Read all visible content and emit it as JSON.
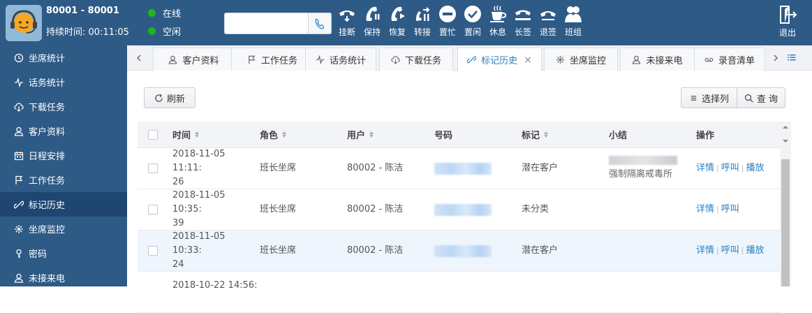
{
  "agent": {
    "id_label": "80001 - 80001",
    "duration_label": "持续时间:",
    "duration_value": "00:11:05"
  },
  "status": {
    "online": "在线",
    "idle": "空闲",
    "dot_color": "#1fb51f"
  },
  "dial": {
    "value": "",
    "placeholder": ""
  },
  "toolbar": [
    {
      "label": "挂断",
      "icon": "hangup-icon"
    },
    {
      "label": "保持",
      "icon": "hold-icon"
    },
    {
      "label": "恢复",
      "icon": "resume-icon"
    },
    {
      "label": "转接",
      "icon": "transfer-icon"
    },
    {
      "label": "置忙",
      "icon": "busy-icon"
    },
    {
      "label": "置闲",
      "icon": "idle-icon"
    },
    {
      "label": "休息",
      "icon": "rest-icon"
    },
    {
      "label": "长签",
      "icon": "long-sign-icon"
    },
    {
      "label": "退签",
      "icon": "sign-out-icon"
    },
    {
      "label": "班组",
      "icon": "team-icon"
    }
  ],
  "logout": {
    "label": "退出"
  },
  "sidebar": {
    "items": [
      {
        "label": "坐席统计",
        "icon": "agent-stats-icon"
      },
      {
        "label": "话务统计",
        "icon": "call-stats-icon"
      },
      {
        "label": "下载任务",
        "icon": "download-icon"
      },
      {
        "label": "客户资料",
        "icon": "customer-icon"
      },
      {
        "label": "日程安排",
        "icon": "calendar-icon"
      },
      {
        "label": "工作任务",
        "icon": "flag-icon"
      },
      {
        "label": "标记历史",
        "icon": "link-icon",
        "active": true
      },
      {
        "label": "坐席监控",
        "icon": "monitor-icon"
      },
      {
        "label": "密码",
        "icon": "key-icon"
      },
      {
        "label": "未接来电",
        "icon": "missed-call-icon"
      }
    ]
  },
  "tabs": [
    {
      "label": "客户资料",
      "icon": "customer-icon"
    },
    {
      "label": "工作任务",
      "icon": "flag-icon"
    },
    {
      "label": "话务统计",
      "icon": "call-stats-icon"
    },
    {
      "label": "下载任务",
      "icon": "download-icon"
    },
    {
      "label": "标记历史",
      "icon": "link-icon",
      "active": true,
      "closable": true
    },
    {
      "label": "坐席监控",
      "icon": "monitor-icon"
    },
    {
      "label": "未接来电",
      "icon": "missed-call-icon"
    },
    {
      "label": "录音清单",
      "icon": "recording-icon"
    }
  ],
  "actions": {
    "refresh": "刷新",
    "select_columns": "选择列",
    "query": "查 询"
  },
  "table": {
    "columns": [
      "时间",
      "角色",
      "用户",
      "号码",
      "标记",
      "小结",
      "操作"
    ],
    "rows": [
      {
        "time": "2018-11-05 11:11:",
        "time2": "26",
        "role": "班长坐席",
        "user": "80002 - 陈洁",
        "mark": "潜在客户",
        "summary": "强制隔离戒毒所",
        "ops": [
          "详情",
          "呼叫",
          "播放"
        ]
      },
      {
        "time": "2018-11-05 10:35:",
        "time2": "39",
        "role": "班长坐席",
        "user": "80002 - 陈洁",
        "mark": "未分类",
        "summary": "",
        "ops": [
          "详情",
          "呼叫"
        ]
      },
      {
        "time": "2018-11-05 10:33:",
        "time2": "24",
        "role": "班长坐席",
        "user": "80002 - 陈洁",
        "mark": "潜在客户",
        "summary": "",
        "ops": [
          "详情",
          "呼叫",
          "播放"
        ]
      },
      {
        "time": "2018-10-22 14:56:",
        "time2": "",
        "role": "",
        "user": "",
        "mark": "",
        "summary": "",
        "ops": []
      }
    ]
  },
  "colors": {
    "header_bg": "#2e5a86",
    "sidebar_active": "#1e4670",
    "link": "#2a7fc1",
    "row_highlight": "#eef5fc"
  }
}
